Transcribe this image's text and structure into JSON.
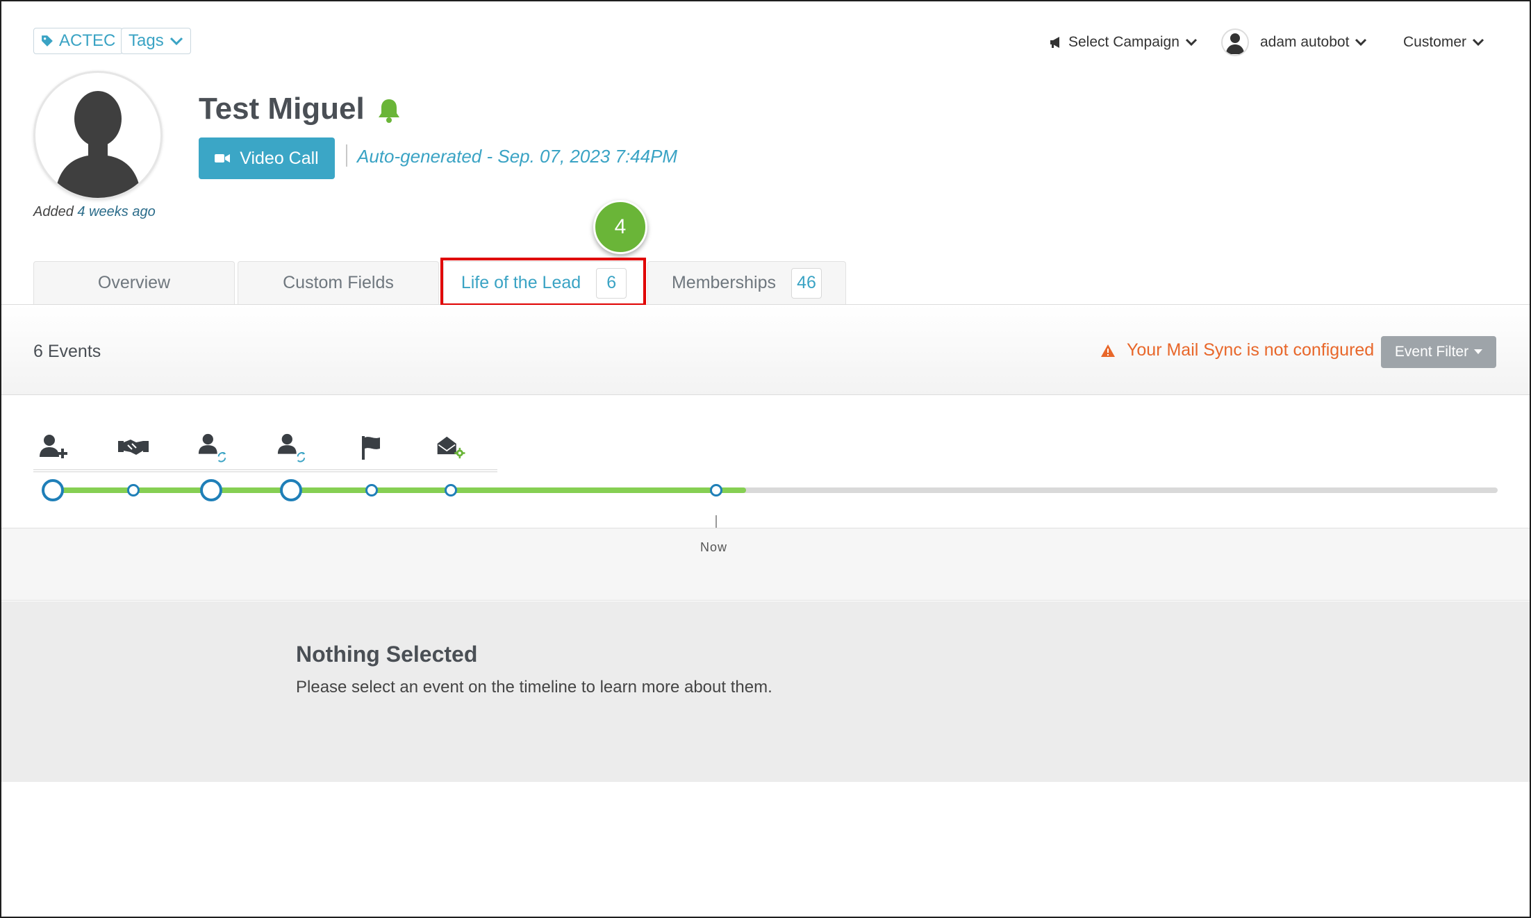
{
  "tags": {
    "tag_label": "ACTEC",
    "tags_button": "Tags"
  },
  "header": {
    "select_campaign": "Select Campaign",
    "user_name": "adam autobot",
    "role_menu": "Customer"
  },
  "contact": {
    "name": "Test Miguel",
    "video_call_label": "Video Call",
    "auto_generated": "Auto-generated - Sep. 07, 2023 7:44PM",
    "added_prefix": "Added",
    "added_ago": "4 weeks ago"
  },
  "callout": {
    "step": "4"
  },
  "tabs": [
    {
      "label": "Overview",
      "count": ""
    },
    {
      "label": "Custom Fields",
      "count": ""
    },
    {
      "label": "Life of the Lead",
      "count": "6",
      "active": true
    },
    {
      "label": "Memberships",
      "count": "46"
    }
  ],
  "events": {
    "count_label": "6 Events",
    "mail_sync_warning": "Your Mail Sync is not configured",
    "event_filter_label": "Event Filter"
  },
  "timeline": {
    "icons": [
      "user-add-icon",
      "handshake-icon",
      "user-sync-icon",
      "user-sync-icon",
      "flag-icon",
      "envelope-gear-icon"
    ],
    "now_label": "Now",
    "colors": {
      "accent": "#3ba6c6",
      "progress": "#86cf53",
      "node": "#1f7fb8",
      "warning": "#e8672a",
      "highlight": "#e00000"
    }
  },
  "detail": {
    "title": "Nothing Selected",
    "message": "Please select an event on the timeline to learn more about them."
  }
}
